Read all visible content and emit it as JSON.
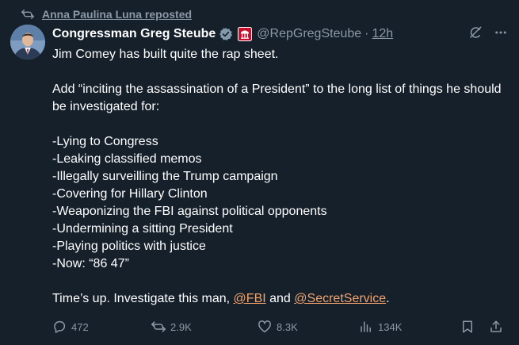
{
  "repost": {
    "icon": "repost-icon",
    "text": "Anna Paulina Luna reposted"
  },
  "author": {
    "display_name": "Congressman Greg Steube",
    "handle": "@RepGregSteube",
    "separator": "·",
    "time": "12h",
    "verified_icon": "verified-badge-icon",
    "affiliation_icon": "affiliation-badge-icon"
  },
  "tweet": {
    "line1": "Jim Comey has built quite the rap sheet.",
    "line2": "Add “inciting the assassination of a President” to the long list of things he should be investigated for:",
    "list": [
      "-Lying to Congress",
      "-Leaking classified memos",
      "-Illegally surveilling the Trump campaign",
      "-Covering for Hillary Clinton",
      "-Weaponizing the FBI against political opponents",
      "-Undermining a sitting President",
      "-Playing politics with justice",
      "-Now: “86 47”"
    ],
    "closing_prefix": "Time’s up. Investigate this man, ",
    "mention1": "@FBI",
    "closing_mid": " and ",
    "mention2": "@SecretService",
    "closing_suffix": "."
  },
  "actions": {
    "replies": "472",
    "reposts": "2.9K",
    "likes": "8.3K",
    "views": "134K"
  },
  "colors": {
    "background": "#15202b",
    "text": "#ffffff",
    "muted": "#8b98a5",
    "mention": "#f4a36c",
    "verified": "#829aab"
  }
}
